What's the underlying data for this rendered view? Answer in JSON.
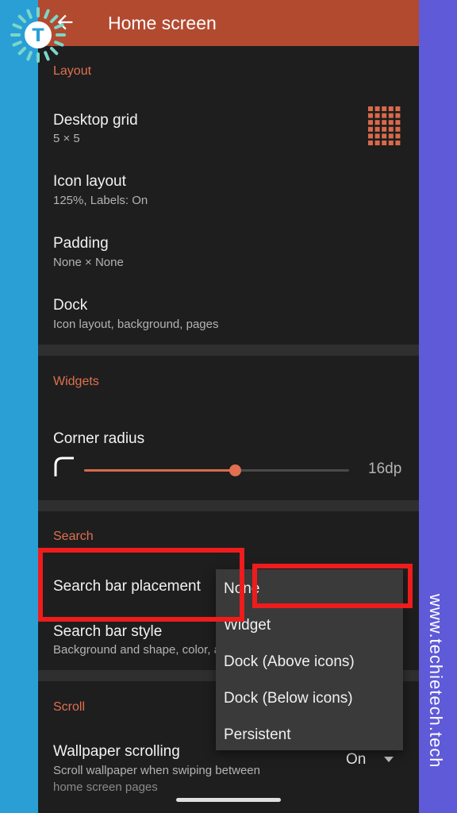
{
  "appbar": {
    "title": "Home screen",
    "back_icon": "arrow-left-icon"
  },
  "sections": {
    "layout": {
      "header": "Layout"
    },
    "widgets": {
      "header": "Widgets"
    },
    "search": {
      "header": "Search"
    },
    "scroll": {
      "header": "Scroll"
    }
  },
  "layout_items": [
    {
      "title": "Desktop grid",
      "subtitle": "5 × 5"
    },
    {
      "title": "Icon layout",
      "subtitle": "125%, Labels: On"
    },
    {
      "title": "Padding",
      "subtitle": "None × None"
    },
    {
      "title": "Dock",
      "subtitle": "Icon layout, background, pages"
    }
  ],
  "widgets": {
    "corner_radius": {
      "title": "Corner radius",
      "value": "16dp",
      "level_fraction": 0.57
    }
  },
  "search_items": [
    {
      "title": "Search bar placement"
    },
    {
      "title": "Search bar style",
      "subtitle": "Background and shape, color, and"
    }
  ],
  "scroll_items": [
    {
      "title": "Wallpaper scrolling",
      "subtitle_line1": "Scroll wallpaper when swiping between",
      "subtitle_line2": "home screen pages",
      "value": "On"
    }
  ],
  "dropdown": {
    "options": [
      "None",
      "Widget",
      "Dock (Above icons)",
      "Dock (Below icons)",
      "Persistent"
    ],
    "selected": "None"
  },
  "branding": {
    "logo_letter": "T",
    "watermark": "www.techietech.tech"
  },
  "colors": {
    "accent": "#b24a30",
    "section": "#e0704f",
    "highlight": "#ee1c1c",
    "left_band": "#2a9fd6",
    "right_band": "#5f5ad8"
  }
}
